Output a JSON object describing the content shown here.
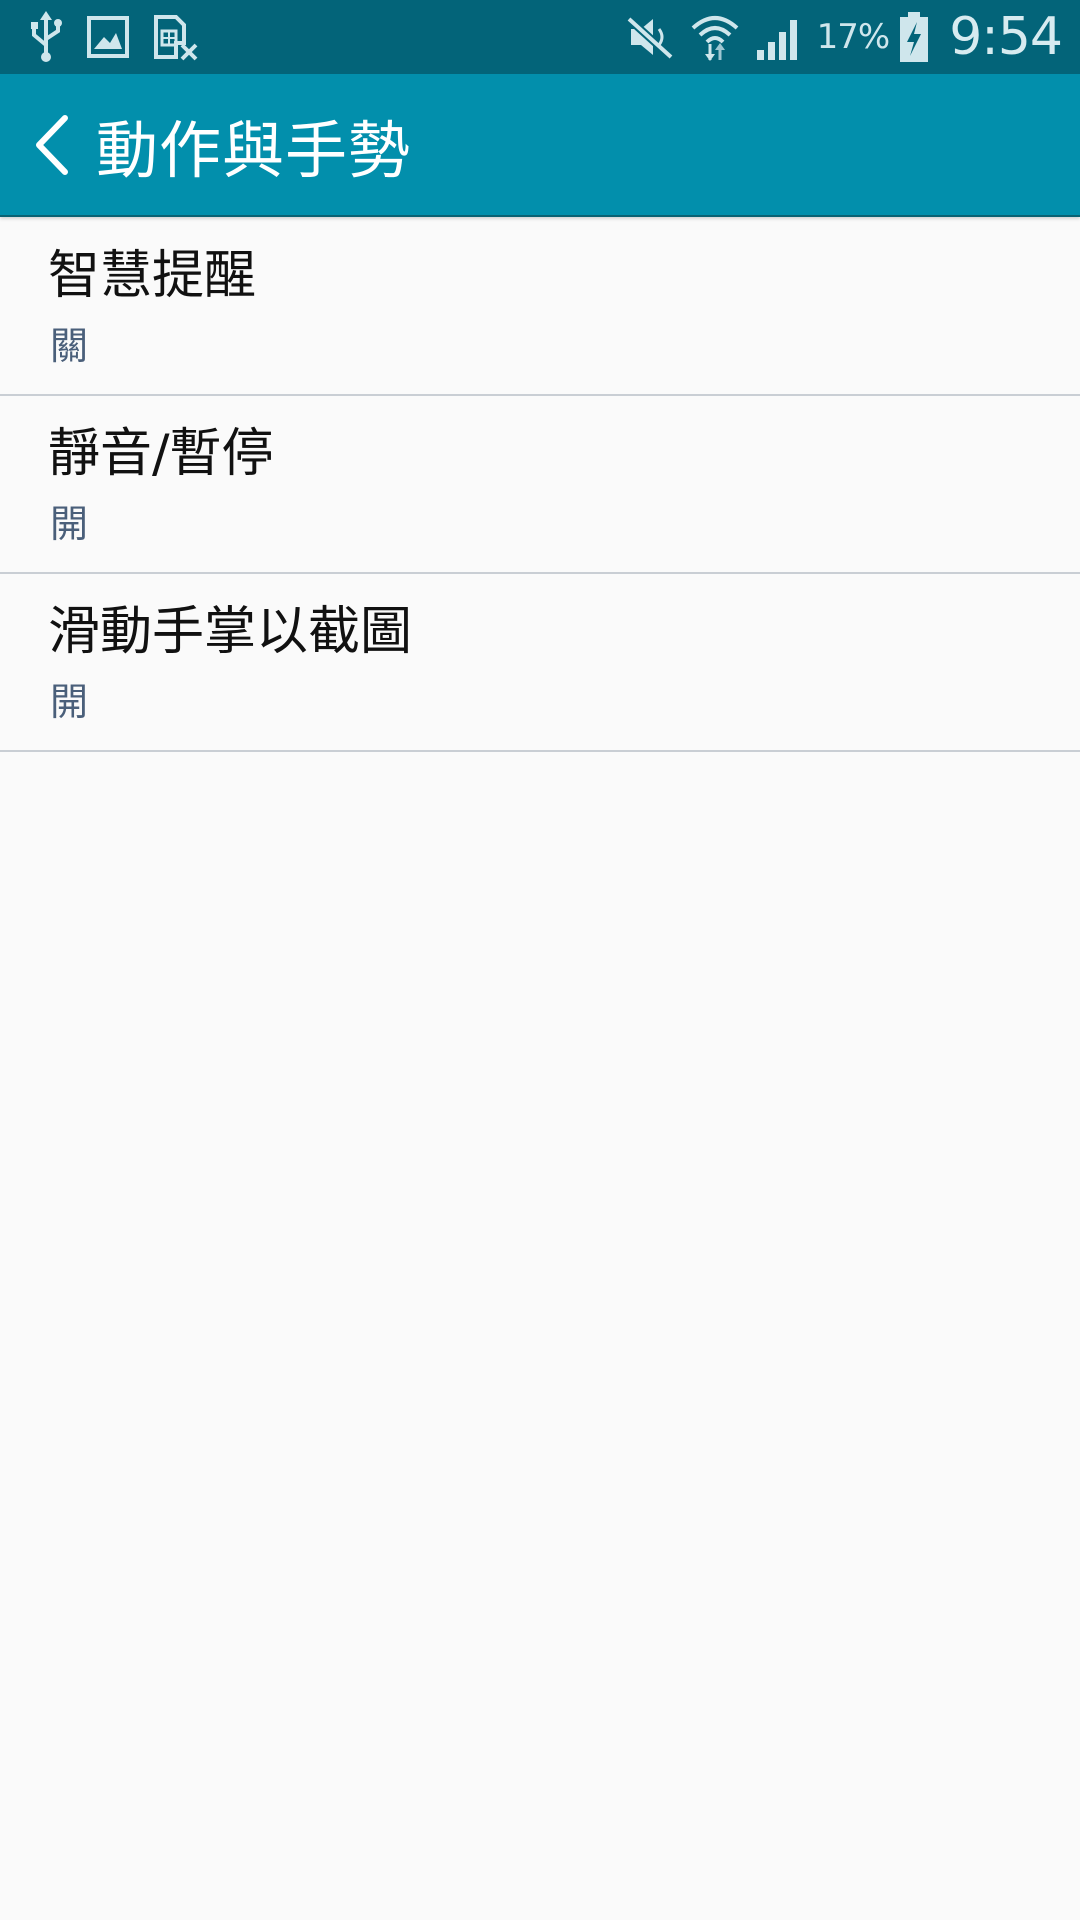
{
  "status_bar": {
    "left_icons": [
      "usb-icon",
      "image-icon",
      "no-sim-icon"
    ],
    "right_icons": [
      "mute-icon",
      "wifi-icon",
      "signal-icon",
      "battery-charging-icon"
    ],
    "battery_percent": "17%",
    "time": "9:54"
  },
  "app_bar": {
    "back_icon": "chevron-left-icon",
    "title": "動作與手勢"
  },
  "settings": {
    "items": [
      {
        "title": "智慧提醒",
        "summary": "關"
      },
      {
        "title": "靜音/暫停",
        "summary": "開"
      },
      {
        "title": "滑動手掌以截圖",
        "summary": "開"
      }
    ]
  },
  "colors": {
    "status_bar_bg": "#036479",
    "app_bar_bg": "#028fac",
    "page_bg": "#fafafa",
    "summary_text": "#4a5f7a",
    "divider": "#c9ced4"
  }
}
